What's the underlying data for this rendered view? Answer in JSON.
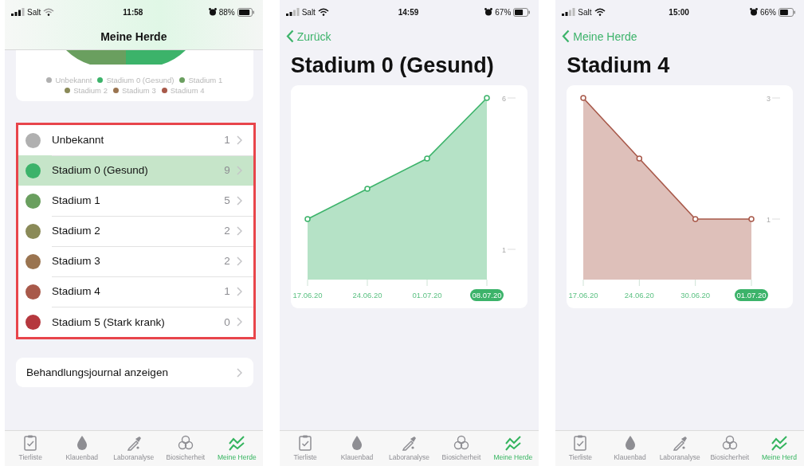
{
  "screens": [
    {
      "kind": "overview",
      "status_bar": {
        "carrier": "Salt",
        "time": "11:58",
        "battery": "88%"
      },
      "nav_title": "Meine Herde",
      "legend": [
        {
          "label": "Unbekannt",
          "color": "#b0b0b0"
        },
        {
          "label": "Stadium 0 (Gesund)",
          "color": "#3cb36a"
        },
        {
          "label": "Stadium 1",
          "color": "#6a9f5f"
        },
        {
          "label": "Stadium 2",
          "color": "#8a8a58"
        },
        {
          "label": "Stadium 3",
          "color": "#9a7450"
        },
        {
          "label": "Stadium 4",
          "color": "#a8594a"
        }
      ],
      "stages_highlighted": true,
      "stages": [
        {
          "label": "Unbekannt",
          "count": "1",
          "color": "#b0b0b0",
          "selected": false
        },
        {
          "label": "Stadium 0 (Gesund)",
          "count": "9",
          "color": "#3cb36a",
          "selected": true
        },
        {
          "label": "Stadium 1",
          "count": "5",
          "color": "#6a9f5f",
          "selected": false
        },
        {
          "label": "Stadium 2",
          "count": "2",
          "color": "#8a8a58",
          "selected": false
        },
        {
          "label": "Stadium 3",
          "count": "2",
          "color": "#9a7450",
          "selected": false
        },
        {
          "label": "Stadium 4",
          "count": "1",
          "color": "#a8594a",
          "selected": false
        },
        {
          "label": "Stadium 5 (Stark krank)",
          "count": "0",
          "color": "#b5383e",
          "selected": false
        }
      ],
      "journal_button": "Behandlungsjournal anzeigen",
      "tab_bar": [
        {
          "label": "Tierliste",
          "selected": false
        },
        {
          "label": "Klauenbad",
          "selected": false
        },
        {
          "label": "Laboranalyse",
          "selected": false
        },
        {
          "label": "Biosicherheit",
          "selected": false
        },
        {
          "label": "Meine Herde",
          "selected": true
        }
      ]
    },
    {
      "kind": "detail",
      "status_bar": {
        "carrier": "Salt",
        "time": "14:59",
        "battery": "67%"
      },
      "back_label": "Zurück",
      "title": "Stadium 0 (Gesund)",
      "chart_data": {
        "type": "area",
        "categories": [
          "17.06.20",
          "24.06.20",
          "01.07.20",
          "08.07.20"
        ],
        "series": [
          {
            "color": "#3cb36a",
            "values": [
              2,
              3,
              4,
              6
            ]
          }
        ],
        "ylim": [
          0,
          6
        ],
        "yticks": [
          1,
          6
        ],
        "annotations": [
          {
            "x": "08.07.20"
          }
        ]
      },
      "tab_bar": [
        {
          "label": "Tierliste",
          "selected": false
        },
        {
          "label": "Klauenbad",
          "selected": false
        },
        {
          "label": "Laboranalyse",
          "selected": false
        },
        {
          "label": "Biosicherheit",
          "selected": false
        },
        {
          "label": "Meine Herde",
          "selected": true
        }
      ]
    },
    {
      "kind": "detail",
      "status_bar": {
        "carrier": "Salt",
        "time": "15:00",
        "battery": "66%"
      },
      "back_label": "Meine Herde",
      "title": "Stadium 4",
      "chart_data": {
        "type": "area",
        "categories": [
          "17.06.20",
          "24.06.20",
          "30.06.20",
          "01.07.20"
        ],
        "series": [
          {
            "color": "#a8594a",
            "values": [
              3,
              2,
              1,
              1
            ]
          }
        ],
        "ylim": [
          0,
          3
        ],
        "yticks": [
          1,
          3
        ],
        "annotations": [
          {
            "x": "01.07.20"
          }
        ]
      },
      "tab_bar": [
        {
          "label": "Tierliste",
          "selected": false
        },
        {
          "label": "Klauenbad",
          "selected": false
        },
        {
          "label": "Laboranalyse",
          "selected": false
        },
        {
          "label": "Biosicherheit",
          "selected": false
        },
        {
          "label": "Meine Herd",
          "selected": true
        }
      ]
    }
  ]
}
